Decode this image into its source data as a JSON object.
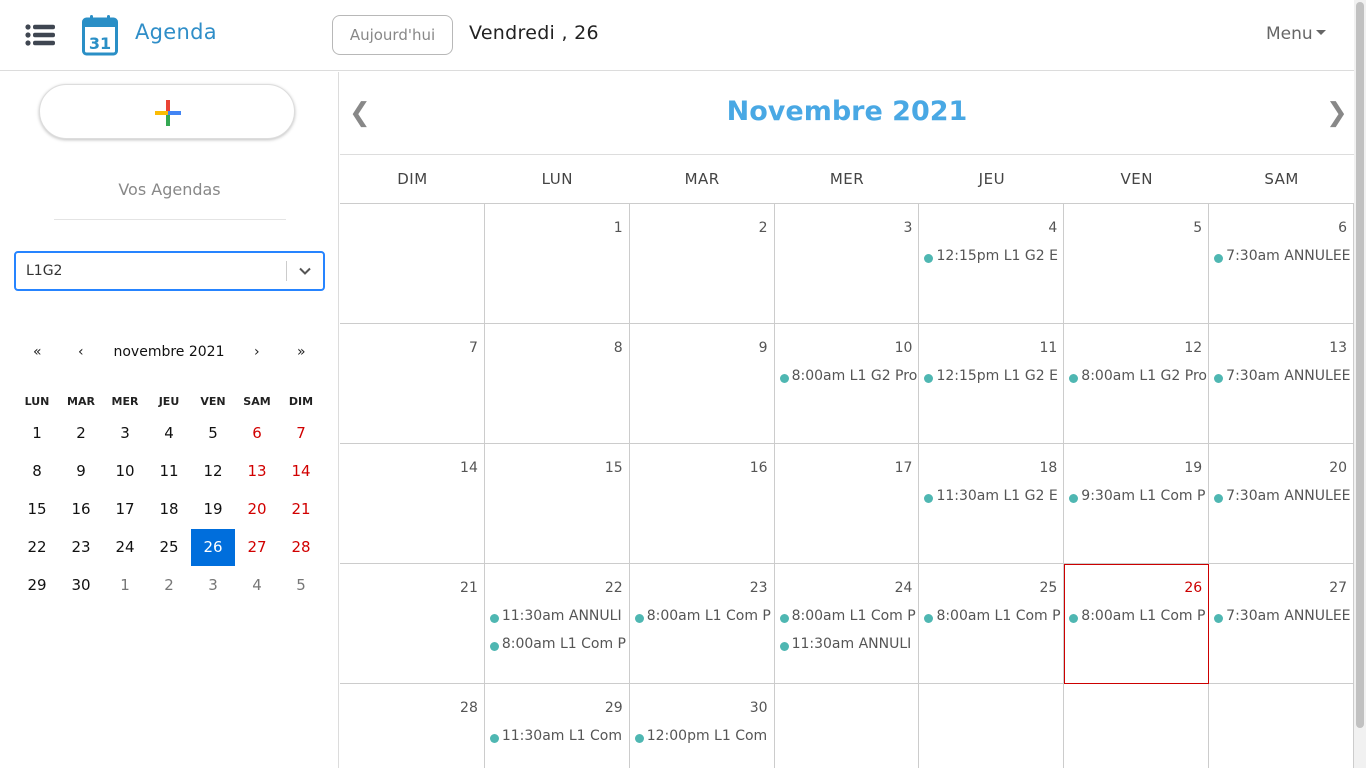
{
  "header": {
    "app_title": "Agenda",
    "logo_day": "31",
    "today_label": "Aujourd'hui",
    "current_date": "Vendredi , 26",
    "menu_label": "Menu"
  },
  "sidebar": {
    "agendas_title": "Vos Agendas",
    "selected_agenda": "L1G2",
    "mini_calendar": {
      "month_label": "novembre 2021",
      "nav_prev_year": "«",
      "nav_prev": "‹",
      "nav_next": "›",
      "nav_next_year": "»",
      "weekdays": [
        "LUN",
        "MAR",
        "MER",
        "JEU",
        "VEN",
        "SAM",
        "DIM"
      ],
      "weeks": [
        [
          "1",
          "2",
          "3",
          "4",
          "5",
          "6",
          "7"
        ],
        [
          "8",
          "9",
          "10",
          "11",
          "12",
          "13",
          "14"
        ],
        [
          "15",
          "16",
          "17",
          "18",
          "19",
          "20",
          "21"
        ],
        [
          "22",
          "23",
          "24",
          "25",
          "26",
          "27",
          "28"
        ],
        [
          "29",
          "30",
          "1",
          "2",
          "3",
          "4",
          "5"
        ]
      ],
      "selected_day": "26"
    }
  },
  "calendar": {
    "month_title": "Novembre 2021",
    "prev_arrow": "❮",
    "next_arrow": "❯",
    "weekdays": [
      "DIM",
      "LUN",
      "MAR",
      "MER",
      "JEU",
      "VEN",
      "SAM"
    ],
    "weeks": [
      [
        {
          "day": "",
          "events": []
        },
        {
          "day": "1",
          "events": []
        },
        {
          "day": "2",
          "events": []
        },
        {
          "day": "3",
          "events": []
        },
        {
          "day": "4",
          "events": [
            "12:15pm L1 G2 E"
          ]
        },
        {
          "day": "5",
          "events": []
        },
        {
          "day": "6",
          "events": [
            "7:30am ANNULEE"
          ]
        }
      ],
      [
        {
          "day": "7",
          "events": []
        },
        {
          "day": "8",
          "events": []
        },
        {
          "day": "9",
          "events": []
        },
        {
          "day": "10",
          "events": [
            "8:00am L1 G2 Pro"
          ]
        },
        {
          "day": "11",
          "events": [
            "12:15pm L1 G2 E"
          ]
        },
        {
          "day": "12",
          "events": [
            "8:00am L1 G2 Pro"
          ]
        },
        {
          "day": "13",
          "events": [
            "7:30am ANNULEE"
          ]
        }
      ],
      [
        {
          "day": "14",
          "events": []
        },
        {
          "day": "15",
          "events": []
        },
        {
          "day": "16",
          "events": []
        },
        {
          "day": "17",
          "events": []
        },
        {
          "day": "18",
          "events": [
            "11:30am L1 G2 E"
          ]
        },
        {
          "day": "19",
          "events": [
            "9:30am L1 Com P"
          ]
        },
        {
          "day": "20",
          "events": [
            "7:30am ANNULEE"
          ]
        }
      ],
      [
        {
          "day": "21",
          "events": []
        },
        {
          "day": "22",
          "events": [
            "11:30am ANNULI",
            "8:00am L1 Com P"
          ]
        },
        {
          "day": "23",
          "events": [
            "8:00am L1 Com P"
          ]
        },
        {
          "day": "24",
          "events": [
            "8:00am L1 Com P",
            "11:30am ANNULI"
          ]
        },
        {
          "day": "25",
          "events": [
            "8:00am L1 Com P"
          ]
        },
        {
          "day": "26",
          "events": [
            "8:00am L1 Com P"
          ],
          "today": true
        },
        {
          "day": "27",
          "events": [
            "7:30am ANNULEE"
          ]
        }
      ],
      [
        {
          "day": "28",
          "events": []
        },
        {
          "day": "29",
          "events": [
            "11:30am L1 Com"
          ]
        },
        {
          "day": "30",
          "events": [
            "12:00pm L1 Com"
          ]
        },
        {
          "day": "",
          "events": []
        },
        {
          "day": "",
          "events": []
        },
        {
          "day": "",
          "events": []
        },
        {
          "day": "",
          "events": []
        }
      ]
    ]
  },
  "colors": {
    "accent": "#2f8ec8",
    "month_title": "#49a8e4",
    "event_dot": "#4fb7b2",
    "today_border": "#cc0000",
    "selected_day_bg": "#006edc",
    "weekend_text": "#d10000"
  },
  "icons": {
    "menu": "hamburger-list-icon",
    "logo": "calendar-31-icon",
    "add": "multicolor-plus-icon",
    "select_chevron": "chevron-down-icon"
  }
}
